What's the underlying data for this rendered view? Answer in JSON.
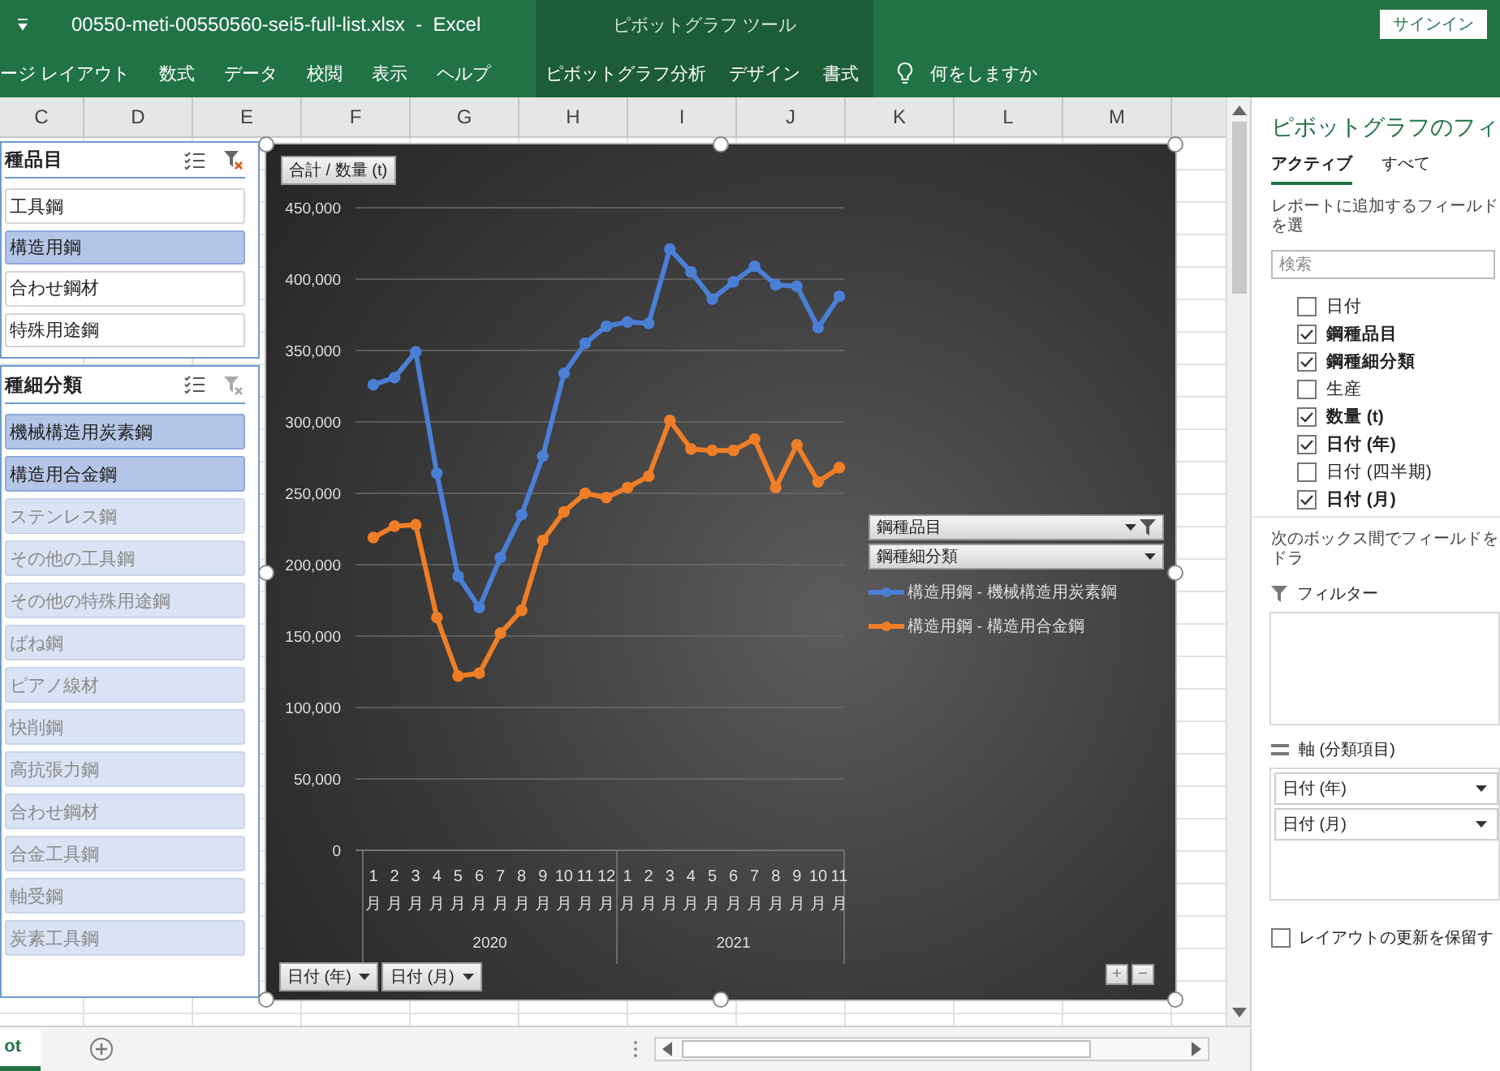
{
  "title_bar": {
    "filename": "00550-meti-00550560-sei5-full-list.xlsx  -  Excel",
    "context_title": "ピボットグラフ ツール",
    "signin": "サインイン"
  },
  "ribbon_tabs": [
    {
      "label": "ージ レイアウト",
      "contextual": false
    },
    {
      "label": "数式",
      "contextual": false
    },
    {
      "label": "データ",
      "contextual": false
    },
    {
      "label": "校閲",
      "contextual": false
    },
    {
      "label": "表示",
      "contextual": false
    },
    {
      "label": "ヘルプ",
      "contextual": false
    },
    {
      "label": "ピボットグラフ分析",
      "contextual": true
    },
    {
      "label": "デザイン",
      "contextual": true
    },
    {
      "label": "書式",
      "contextual": true
    }
  ],
  "tell_me": "何をしますか",
  "columns": [
    "C",
    "D",
    "E",
    "F",
    "G",
    "H",
    "I",
    "J",
    "K",
    "L",
    "M"
  ],
  "slicers": [
    {
      "title": "種品目",
      "filter_active": true,
      "items": [
        {
          "label": "工具鋼",
          "selected": false,
          "has_data": true
        },
        {
          "label": "構造用鋼",
          "selected": true,
          "has_data": true
        },
        {
          "label": "合わせ鋼材",
          "selected": false,
          "has_data": true
        },
        {
          "label": "特殊用途鋼",
          "selected": false,
          "has_data": true
        }
      ]
    },
    {
      "title": "種細分類",
      "filter_active": false,
      "items": [
        {
          "label": "機械構造用炭素鋼",
          "selected": true,
          "has_data": true
        },
        {
          "label": "構造用合金鋼",
          "selected": true,
          "has_data": true
        },
        {
          "label": "ステンレス鋼",
          "selected": false,
          "has_data": false
        },
        {
          "label": "その他の工具鋼",
          "selected": false,
          "has_data": false
        },
        {
          "label": "その他の特殊用途鋼",
          "selected": false,
          "has_data": false
        },
        {
          "label": "ばね鋼",
          "selected": false,
          "has_data": false
        },
        {
          "label": "ピアノ線材",
          "selected": false,
          "has_data": false
        },
        {
          "label": "快削鋼",
          "selected": false,
          "has_data": false
        },
        {
          "label": "高抗張力鋼",
          "selected": false,
          "has_data": false
        },
        {
          "label": "合わせ鋼材",
          "selected": false,
          "has_data": false
        },
        {
          "label": "合金工具鋼",
          "selected": false,
          "has_data": false
        },
        {
          "label": "軸受鋼",
          "selected": false,
          "has_data": false
        },
        {
          "label": "炭素工具鋼",
          "selected": false,
          "has_data": false
        }
      ]
    }
  ],
  "chart": {
    "value_button": "合計 / 数量 (t)",
    "legend_buttons": [
      {
        "label": "鋼種品目",
        "filtered": true
      },
      {
        "label": "鋼種細分類",
        "filtered": false
      }
    ],
    "axis_buttons": [
      "日付 (年)",
      "日付 (月)"
    ],
    "year_groups": [
      "2020",
      "2021"
    ],
    "zoom_buttons": [
      "+",
      "−"
    ],
    "chart_data": {
      "type": "line",
      "categories": [
        "1月",
        "2月",
        "3月",
        "4月",
        "5月",
        "6月",
        "7月",
        "8月",
        "9月",
        "10月",
        "11月",
        "12月",
        "1月",
        "2月",
        "3月",
        "4月",
        "5月",
        "6月",
        "7月",
        "8月",
        "9月",
        "10月",
        "11月"
      ],
      "ylim": [
        0,
        450000
      ],
      "grid": true,
      "legend": true,
      "yticks": [
        {
          "value": 0,
          "label": "0"
        },
        {
          "value": 50000,
          "label": "50,000"
        },
        {
          "value": 100000,
          "label": "100,000"
        },
        {
          "value": 150000,
          "label": "150,000"
        },
        {
          "value": 200000,
          "label": "200,000"
        },
        {
          "value": 250000,
          "label": "250,000"
        },
        {
          "value": 300000,
          "label": "300,000"
        },
        {
          "value": 350000,
          "label": "350,000"
        },
        {
          "value": 400000,
          "label": "400,000"
        },
        {
          "value": 450000,
          "label": "450,000"
        }
      ],
      "series": [
        {
          "name": "構造用鋼 - 機械構造用炭素鋼",
          "color": "#4a7fd6",
          "marker": true,
          "values": [
            326000,
            331000,
            349000,
            264000,
            192000,
            170000,
            205000,
            235000,
            276000,
            334000,
            355000,
            367000,
            370000,
            369000,
            421000,
            405000,
            386000,
            398000,
            409000,
            396000,
            395000,
            366000,
            388000
          ]
        },
        {
          "name": "構造用鋼 - 構造用合金鋼",
          "color": "#f07e26",
          "marker": true,
          "values": [
            219000,
            227000,
            228000,
            163000,
            122000,
            124000,
            152000,
            168000,
            217000,
            237000,
            250000,
            247000,
            254000,
            262000,
            301000,
            281000,
            280000,
            280000,
            288000,
            254000,
            284000,
            258000,
            268000
          ]
        }
      ]
    }
  },
  "sheet_tabs": [
    {
      "label": "ot",
      "selected": true
    }
  ],
  "field_pane": {
    "title": "ピボットグラフのフィ",
    "tabs": [
      {
        "label": "アクティブ",
        "selected": true
      },
      {
        "label": "すべて",
        "selected": false
      }
    ],
    "hint": "レポートに追加するフィールドを選",
    "search": {
      "placeholder": "検索"
    },
    "fields": [
      {
        "label": "日付",
        "checked": false
      },
      {
        "label": "鋼種品目",
        "checked": true
      },
      {
        "label": "鋼種細分類",
        "checked": true
      },
      {
        "label": "生産",
        "checked": false
      },
      {
        "label": "数量 (t)",
        "checked": true
      },
      {
        "label": "日付 (年)",
        "checked": true
      },
      {
        "label": "日付 (四半期)",
        "checked": false
      },
      {
        "label": "日付 (月)",
        "checked": true
      }
    ],
    "drag_hint": "次のボックス間でフィールドをドラ",
    "areas": [
      {
        "kind": "filter",
        "label": "フィルター"
      },
      {
        "kind": "axis",
        "label": "軸 (分類項目)",
        "items": [
          "日付 (年)",
          "日付 (月)"
        ]
      }
    ],
    "defer": {
      "label": "レイアウトの更新を保留す",
      "checked": false
    }
  }
}
